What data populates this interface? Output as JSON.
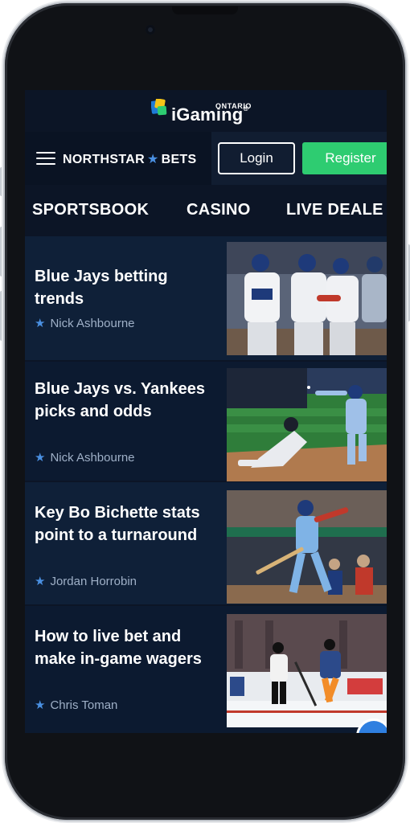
{
  "branding": {
    "igaming_word": "iGaming",
    "igaming_region": "ONTARIO",
    "brand_left": "NORTHSTAR",
    "brand_right": "BETS"
  },
  "header": {
    "login_label": "Login",
    "register_label": "Register"
  },
  "tabs": [
    "SPORTSBOOK",
    "CASINO",
    "LIVE DEALE"
  ],
  "articles": [
    {
      "title": "Blue Jays betting trends",
      "author": "Nick Ashbourne",
      "thumbnail": "baseball-celebration-photo"
    },
    {
      "title": "Blue Jays vs. Yankees picks and odds",
      "author": "Nick Ashbourne",
      "thumbnail": "baseball-slide-photo"
    },
    {
      "title": "Key Bo Bichette stats point to a turnaround",
      "author": "Jordan Horrobin",
      "thumbnail": "baseball-batter-photo"
    },
    {
      "title": "How to live bet and make in-game wagers",
      "author": "Chris Toman",
      "thumbnail": "hockey-game-photo"
    }
  ],
  "colors": {
    "background": "#0c1526",
    "accent_green": "#2ecc71",
    "star_blue": "#4a90e2"
  }
}
